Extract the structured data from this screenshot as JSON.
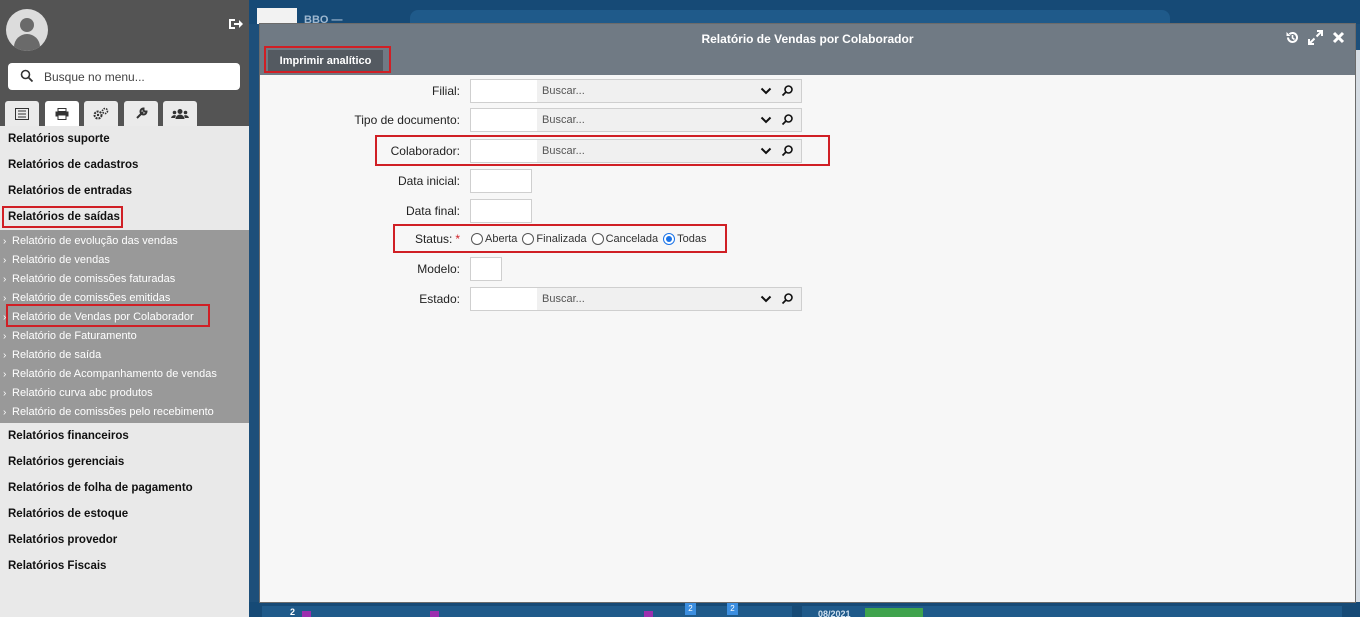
{
  "sidebar": {
    "search_placeholder": "Busque no menu...",
    "categories": [
      "Relatórios suporte",
      "Relatórios de cadastros",
      "Relatórios de entradas",
      "Relatórios de saídas"
    ],
    "subitems": [
      "Relatório de evolução das vendas",
      "Relatório de vendas",
      "Relatório de comissões faturadas",
      "Relatório de comissões emitidas",
      "Relatório de Vendas por Colaborador",
      "Relatório de Faturamento",
      "Relatório de saída",
      "Relatório de Acompanhamento de vendas",
      "Relatório curva abc produtos",
      "Relatório de comissões pelo recebimento"
    ],
    "categories_after": [
      "Relatórios financeiros",
      "Relatórios gerenciais",
      "Relatórios de folha de pagamento",
      "Relatórios de estoque",
      "Relatórios provedor",
      "Relatórios Fiscais"
    ],
    "tabs": [
      "list-icon",
      "printer-icon",
      "gears-icon",
      "wrench-icon",
      "users-icon"
    ]
  },
  "background": {
    "header_text": "BBO —",
    "date_label": "08/2021",
    "left_count": "2",
    "badge_a": "2",
    "badge_b": "2"
  },
  "modal": {
    "title": "Relatório de Vendas por Colaborador",
    "print_button": "Imprimir analítico",
    "fields": {
      "filial_label": "Filial:",
      "tipo_label": "Tipo de documento:",
      "colaborador_label": "Colaborador:",
      "data_inicial_label": "Data inicial:",
      "data_final_label": "Data final:",
      "status_label": "Status:",
      "status_required": "*",
      "modelo_label": "Modelo:",
      "estado_label": "Estado:",
      "search_placeholder": "Buscar..."
    },
    "status_options": [
      {
        "label": "Aberta",
        "selected": false
      },
      {
        "label": "Finalizada",
        "selected": false
      },
      {
        "label": "Cancelada",
        "selected": false
      },
      {
        "label": "Todas",
        "selected": true
      }
    ]
  },
  "colors": {
    "highlight": "#d01f25",
    "header_bg": "#707a84",
    "sidebar_top": "#545454",
    "radio_selected": "#1a73e8"
  }
}
